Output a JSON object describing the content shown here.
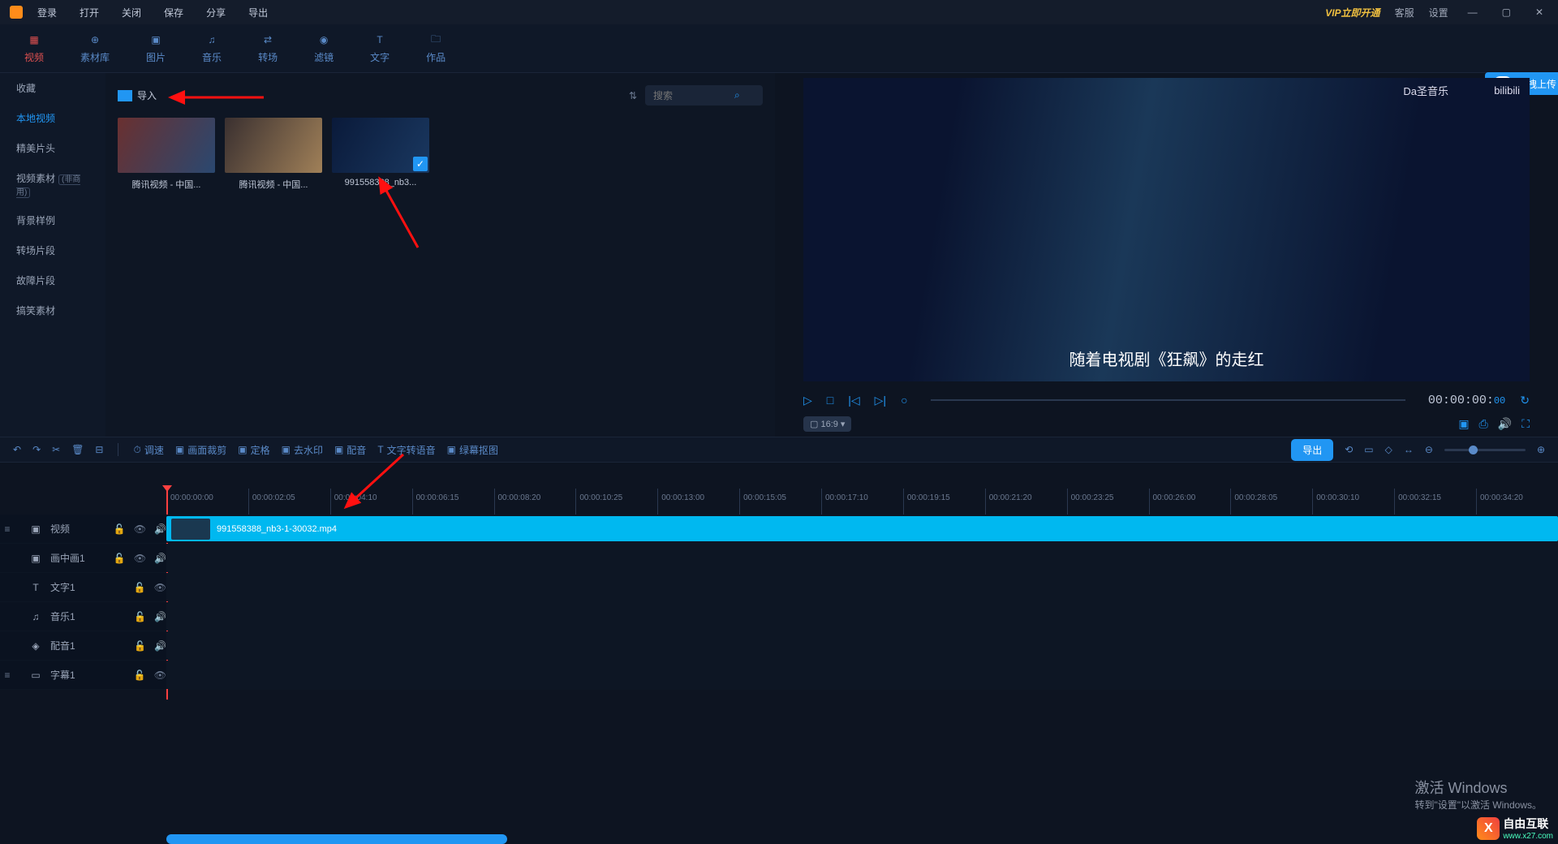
{
  "titlebar": {
    "login": "登录",
    "open": "打开",
    "close": "关闭",
    "save": "保存",
    "share": "分享",
    "export": "导出",
    "vip": "VIP立即开通",
    "kefu": "客服",
    "settings": "设置"
  },
  "ribbon": {
    "video": "视频",
    "material": "素材库",
    "image": "图片",
    "music": "音乐",
    "transition": "转场",
    "filter": "滤镜",
    "text": "文字",
    "works": "作品"
  },
  "categories": {
    "favorite": "收藏",
    "local_video": "本地视频",
    "fine_opening": "精美片头",
    "video_material": "视频素材",
    "non_commercial": "(非商用)",
    "background_sample": "背景样例",
    "transition_clip": "转场片段",
    "fault_clip": "故障片段",
    "funny_material": "搞笑素材"
  },
  "import": {
    "label": "导入"
  },
  "search": {
    "placeholder": "搜索"
  },
  "thumbs": [
    {
      "label": "腾讯视频 - 中国..."
    },
    {
      "label": "腾讯视频 - 中国..."
    },
    {
      "label": "991558388_nb3..."
    }
  ],
  "preview": {
    "watermark_left": "Da圣音乐",
    "watermark_right": "bilibili",
    "subtitle": "随着电视剧《狂飙》的走红",
    "upload_label": "拖拽上传",
    "timecode": "00:00:00:00",
    "ratio": "16:9"
  },
  "toolbar": {
    "speed": "调速",
    "crop": "画面裁剪",
    "freeze": "定格",
    "no_watermark": "去水印",
    "dub": "配音",
    "tts": "文字转语音",
    "greenscreen": "绿幕抠图",
    "export": "导出"
  },
  "ruler_ticks": [
    "00:00:00:00",
    "00:00:02:05",
    "00:00:04:10",
    "00:00:06:15",
    "00:00:08:20",
    "00:00:10:25",
    "00:00:13:00",
    "00:00:15:05",
    "00:00:17:10",
    "00:00:19:15",
    "00:00:21:20",
    "00:00:23:25",
    "00:00:26:00",
    "00:00:28:05",
    "00:00:30:10",
    "00:00:32:15",
    "00:00:34:20"
  ],
  "tracks": {
    "video": "视频",
    "pip": "画中画1",
    "text": "文字1",
    "music": "音乐1",
    "dub": "配音1",
    "subtitle": "字幕1"
  },
  "clip": {
    "name": "991558388_nb3-1-30032.mp4"
  },
  "windows": {
    "line1": "激活 Windows",
    "line2": "转到\"设置\"以激活 Windows。"
  },
  "watermark_site": {
    "name": "自由互联",
    "url": "www.x27.com"
  }
}
